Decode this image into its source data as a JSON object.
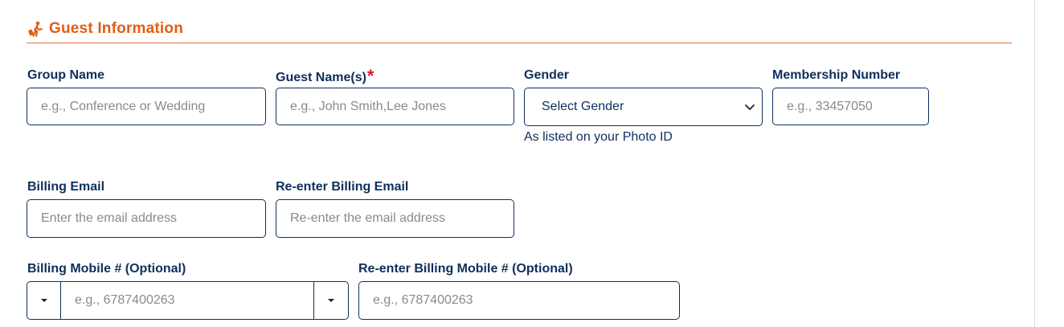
{
  "section": {
    "title": "Guest Information",
    "icon": "traveler-luggage-icon",
    "accent_color": "#e35d12"
  },
  "fields": {
    "group_name": {
      "label": "Group Name",
      "placeholder": "e.g., Conference or Wedding"
    },
    "guest_names": {
      "label": "Guest Name(s)",
      "required_mark": "*",
      "placeholder": "e.g., John Smith,Lee Jones"
    },
    "gender": {
      "label": "Gender",
      "selected": "Select Gender",
      "helper": "As listed on your Photo ID"
    },
    "membership_number": {
      "label": "Membership Number",
      "placeholder": "e.g., 33457050"
    },
    "billing_email": {
      "label": "Billing Email",
      "placeholder": "Enter the email address"
    },
    "reenter_billing_email": {
      "label": "Re-enter Billing Email",
      "placeholder": "Re-enter the email address"
    },
    "billing_mobile": {
      "label": "Billing Mobile # (Optional)",
      "placeholder": "e.g., 6787400263"
    },
    "reenter_billing_mobile": {
      "label": "Re-enter Billing Mobile # (Optional)",
      "placeholder": "e.g., 6787400263"
    }
  },
  "colors": {
    "label": "#0e2f5c",
    "border": "#0e2f5c",
    "required": "#e0161d",
    "divider": "#e8702a"
  }
}
